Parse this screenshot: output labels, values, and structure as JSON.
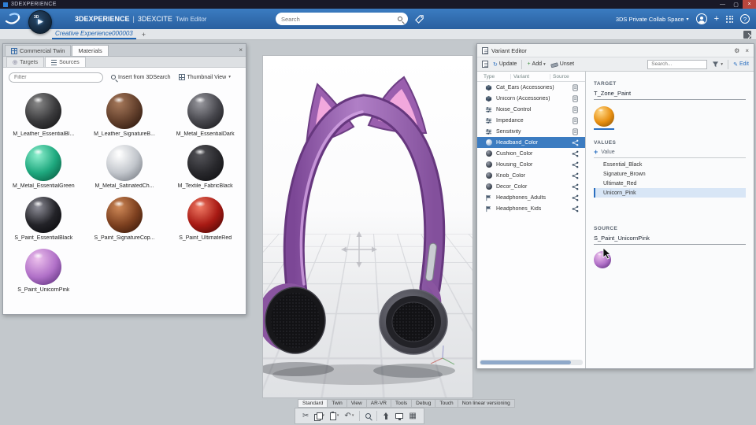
{
  "titlebar": {
    "title": "3DEXPERIENCE"
  },
  "icons": {
    "minimize": "—",
    "maximize": "▢",
    "close": "×",
    "chevron_down": "▾",
    "plus": "+",
    "help": "?",
    "gear": "⚙",
    "scissors": "✂",
    "undo": "↶",
    "pencil": "✎",
    "refresh": "↻",
    "play": "▶",
    "target": "◎",
    "grid": "▦"
  },
  "colors": {
    "accent_blue": "#2a6fc0",
    "selection_blue": "#3c7cc1",
    "topbar_blue": "#2f72b6",
    "headphone_purple": "#9a5fae",
    "ear_pink": "#f2a8dd"
  },
  "header": {
    "brand": {
      "name": "3DEXPERIENCE",
      "sep": "|",
      "app": "3DEXCITE",
      "sub": "Twin Editor"
    },
    "compass_label": "3D",
    "search_placeholder": "Search",
    "collab_space": "3DS Private Collab Space"
  },
  "tabstrip": {
    "active_tab": "Creative Experience000003"
  },
  "left_panel": {
    "tabs": [
      {
        "label": "Commercial Twin"
      },
      {
        "label": "Materials"
      }
    ],
    "subtabs": [
      {
        "label": "Targets"
      },
      {
        "label": "Sources"
      }
    ],
    "filter_placeholder": "Filter",
    "insert_button": "Insert from 3DSearch",
    "view_button": "Thumbnail View",
    "materials": [
      {
        "label": "M_Leather_EssentialBl...",
        "hi": "#8a8a8a",
        "mid": "#3a3a3c",
        "lo": "#0c0c0d"
      },
      {
        "label": "M_Leather_SignatureB...",
        "hi": "#a87a5c",
        "mid": "#63402c",
        "lo": "#1f0e06"
      },
      {
        "label": "M_Metal_EssentialDark",
        "hi": "#9a9aa0",
        "mid": "#47474d",
        "lo": "#101013"
      },
      {
        "label": "M_Metal_EssentialGreen",
        "hi": "#8ff0cf",
        "mid": "#1ea87e",
        "lo": "#054a33"
      },
      {
        "label": "M_Metal_SatinatedCh...",
        "hi": "#ffffff",
        "mid": "#c2c6cc",
        "lo": "#676c74"
      },
      {
        "label": "M_Textile_FabricBlack",
        "hi": "#55555a",
        "mid": "#28282c",
        "lo": "#0b0b0d"
      },
      {
        "label": "S_Paint_EssentialBlack",
        "hi": "#90909a",
        "mid": "#232328",
        "lo": "#040406"
      },
      {
        "label": "S_Paint_SignatureCop...",
        "hi": "#d08a58",
        "mid": "#7e4120",
        "lo": "#2a1006"
      },
      {
        "label": "S_Paint_UltimateRed",
        "hi": "#f07a64",
        "mid": "#a81a14",
        "lo": "#380302"
      },
      {
        "label": "S_Paint_UnicornPink",
        "hi": "#ecc0ec",
        "mid": "#b171c8",
        "lo": "#4e2470"
      }
    ]
  },
  "viewport": {
    "toolbar_tabs": [
      "Standard",
      "Twin",
      "View",
      "AR-VR",
      "Tools",
      "Debug",
      "Touch",
      "Non linear versioning"
    ],
    "active_toolbar_tab": "Standard"
  },
  "variant_editor": {
    "title": "Variant Editor",
    "toolbar": {
      "update": "Update",
      "add": "Add",
      "unset": "Unset",
      "search_placeholder": "Search...",
      "edit": "Edit"
    },
    "columns": {
      "type": "Type",
      "variant": "Variant",
      "source": "Source"
    },
    "rows": [
      {
        "name": "Cat_Ears (Accessories)",
        "type_icon": "accessory",
        "source_icon": "book",
        "selected": false
      },
      {
        "name": "Unicorn (Accessories)",
        "type_icon": "accessory",
        "source_icon": "book",
        "selected": false
      },
      {
        "name": "Noise_Control",
        "type_icon": "option",
        "source_icon": "book",
        "selected": false
      },
      {
        "name": "Impedance",
        "type_icon": "option",
        "source_icon": "book",
        "selected": false
      },
      {
        "name": "Sensitivity",
        "type_icon": "option",
        "source_icon": "book",
        "selected": false
      },
      {
        "name": "Headband_Color",
        "type_icon": "color",
        "source_icon": "share",
        "selected": true
      },
      {
        "name": "Cushion_Color",
        "type_icon": "color",
        "source_icon": "share",
        "selected": false
      },
      {
        "name": "Housing_Color",
        "type_icon": "color",
        "source_icon": "share",
        "selected": false
      },
      {
        "name": "Knob_Color",
        "type_icon": "color",
        "source_icon": "share",
        "selected": false
      },
      {
        "name": "Decor_Color",
        "type_icon": "color",
        "source_icon": "share",
        "selected": false
      },
      {
        "name": "Headphones_Adults",
        "type_icon": "flag",
        "source_icon": "share",
        "selected": false
      },
      {
        "name": "Headphones_Kids",
        "type_icon": "flag",
        "source_icon": "share",
        "selected": false
      }
    ],
    "target": {
      "label": "TARGET",
      "value": "T_Zone_Paint",
      "swatch": {
        "hi": "#ffd98a",
        "mid": "#e89012",
        "lo": "#7e4a02"
      }
    },
    "values": {
      "label": "VALUES",
      "add_label": "Value",
      "items": [
        "Essential_Black",
        "Signature_Brown",
        "Ultimate_Red",
        "Unicorn_Pink"
      ],
      "selected": "Unicorn_Pink"
    },
    "source": {
      "label": "SOURCE",
      "value": "S_Paint_UnicornPink",
      "swatch": {
        "hi": "#ecc0ec",
        "mid": "#b171c8",
        "lo": "#4e2470"
      }
    }
  }
}
